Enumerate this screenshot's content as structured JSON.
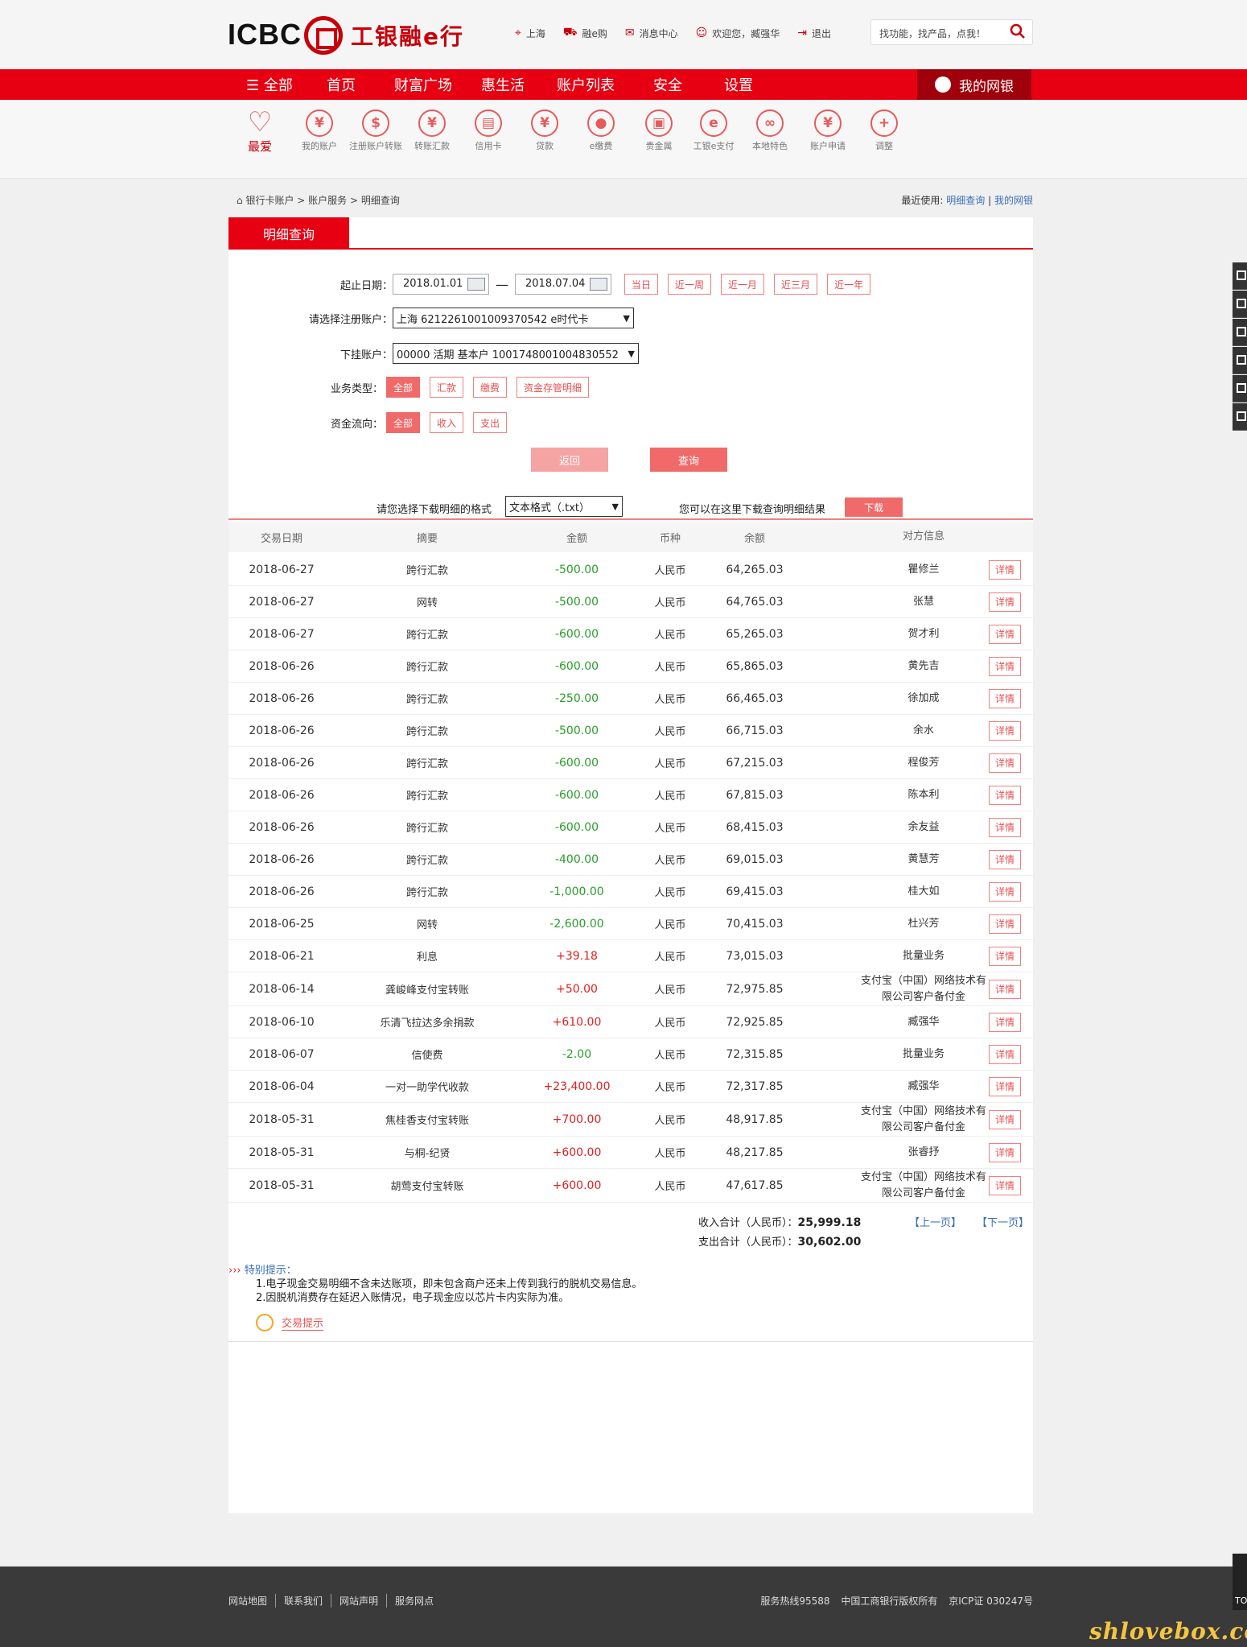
{
  "header": {
    "logo_text": "ICBC",
    "logo_cn": "工银融e行",
    "links": [
      {
        "icon": "location-icon",
        "label": "上海"
      },
      {
        "icon": "cart-icon",
        "label": "融e购"
      },
      {
        "icon": "mail-icon",
        "label": "消息中心"
      },
      {
        "icon": "user-icon",
        "label": "欢迎您，臧强华"
      },
      {
        "icon": "logout-icon",
        "label": "退出"
      }
    ],
    "search_placeholder": "找功能，找产品，点我！"
  },
  "nav": {
    "items": [
      "全部",
      "首页",
      "财富广场",
      "惠生活",
      "账户列表",
      "安全",
      "设置"
    ],
    "mybank": "我的网银"
  },
  "quick_icons": [
    {
      "label": "最爱",
      "glyph": "♡",
      "icon": "heart-icon"
    },
    {
      "label": "我的账户",
      "glyph": "¥",
      "icon": "account-icon"
    },
    {
      "label": "注册账户转账",
      "glyph": "$",
      "icon": "transfer-registered-icon"
    },
    {
      "label": "转账汇款",
      "glyph": "¥",
      "icon": "remittance-icon"
    },
    {
      "label": "信用卡",
      "glyph": "▤",
      "icon": "credit-card-icon"
    },
    {
      "label": "贷款",
      "glyph": "¥",
      "icon": "loan-icon"
    },
    {
      "label": "e缴费",
      "glyph": "●",
      "icon": "epay-icon"
    },
    {
      "label": "贵金属",
      "glyph": "▣",
      "icon": "precious-metal-icon"
    },
    {
      "label": "工银e支付",
      "glyph": "e",
      "icon": "e-payment-icon"
    },
    {
      "label": "本地特色",
      "glyph": "∞",
      "icon": "local-feature-icon"
    },
    {
      "label": "账户申请",
      "glyph": "¥",
      "icon": "account-apply-icon"
    },
    {
      "label": "调整",
      "glyph": "+",
      "icon": "adjust-icon"
    }
  ],
  "breadcrumb": {
    "items": [
      "银行卡账户",
      "账户服务",
      "明细查询"
    ],
    "sep": ">"
  },
  "recent": {
    "label": "最近使用:",
    "links": [
      "明细查询",
      "我的网银"
    ]
  },
  "tab": "明细查询",
  "form": {
    "date_label": "起止日期：",
    "start_date": "2018.01.01",
    "end_date": "2018.07.04",
    "quick_ranges": [
      "当日",
      "近一周",
      "近一月",
      "近三月",
      "近一年"
    ],
    "reg_account_label": "请选择注册账户：",
    "reg_account_value": "上海 6212261001009370542 e时代卡",
    "sub_account_label": "下挂账户：",
    "sub_account_value": "00000 活期 基本户 1001748001004830552",
    "biz_type_label": "业务类型：",
    "biz_types": [
      "全部",
      "汇款",
      "缴费",
      "资金存管明细"
    ],
    "flow_label": "资金流向：",
    "flows": [
      "全部",
      "收入",
      "支出"
    ],
    "back_btn": "返回",
    "query_btn": "查询"
  },
  "download": {
    "format_label": "请您选择下载明细的格式",
    "format_value": "文本格式（.txt）",
    "hint": "您可以在这里下载查询明细结果",
    "btn": "下载"
  },
  "table": {
    "headers": [
      "交易日期",
      "摘要",
      "金额",
      "币种",
      "余额",
      "对方信息"
    ],
    "detail_label": "详情",
    "rows": [
      {
        "date": "2018-06-27",
        "summary": "跨行汇款",
        "amount": "-500.00",
        "currency": "人民币",
        "balance": "64,265.03",
        "party": "瞿修兰"
      },
      {
        "date": "2018-06-27",
        "summary": "网转",
        "amount": "-500.00",
        "currency": "人民币",
        "balance": "64,765.03",
        "party": "张慧"
      },
      {
        "date": "2018-06-27",
        "summary": "跨行汇款",
        "amount": "-600.00",
        "currency": "人民币",
        "balance": "65,265.03",
        "party": "贺才利"
      },
      {
        "date": "2018-06-26",
        "summary": "跨行汇款",
        "amount": "-600.00",
        "currency": "人民币",
        "balance": "65,865.03",
        "party": "黄先吉"
      },
      {
        "date": "2018-06-26",
        "summary": "跨行汇款",
        "amount": "-250.00",
        "currency": "人民币",
        "balance": "66,465.03",
        "party": "徐加成"
      },
      {
        "date": "2018-06-26",
        "summary": "跨行汇款",
        "amount": "-500.00",
        "currency": "人民币",
        "balance": "66,715.03",
        "party": "余水"
      },
      {
        "date": "2018-06-26",
        "summary": "跨行汇款",
        "amount": "-600.00",
        "currency": "人民币",
        "balance": "67,215.03",
        "party": "程俊芳"
      },
      {
        "date": "2018-06-26",
        "summary": "跨行汇款",
        "amount": "-600.00",
        "currency": "人民币",
        "balance": "67,815.03",
        "party": "陈本利"
      },
      {
        "date": "2018-06-26",
        "summary": "跨行汇款",
        "amount": "-600.00",
        "currency": "人民币",
        "balance": "68,415.03",
        "party": "余友益"
      },
      {
        "date": "2018-06-26",
        "summary": "跨行汇款",
        "amount": "-400.00",
        "currency": "人民币",
        "balance": "69,015.03",
        "party": "黄慧芳"
      },
      {
        "date": "2018-06-26",
        "summary": "跨行汇款",
        "amount": "-1,000.00",
        "currency": "人民币",
        "balance": "69,415.03",
        "party": "桂大如"
      },
      {
        "date": "2018-06-25",
        "summary": "网转",
        "amount": "-2,600.00",
        "currency": "人民币",
        "balance": "70,415.03",
        "party": "杜兴芳"
      },
      {
        "date": "2018-06-21",
        "summary": "利息",
        "amount": "+39.18",
        "currency": "人民币",
        "balance": "73,015.03",
        "party": "批量业务"
      },
      {
        "date": "2018-06-14",
        "summary": "龚峻峰支付宝转账",
        "amount": "+50.00",
        "currency": "人民币",
        "balance": "72,975.85",
        "party": "支付宝（中国）网络技术有限公司客户备付金"
      },
      {
        "date": "2018-06-10",
        "summary": "乐清飞拉达多余捐款",
        "amount": "+610.00",
        "currency": "人民币",
        "balance": "72,925.85",
        "party": "臧强华"
      },
      {
        "date": "2018-06-07",
        "summary": "信使费",
        "amount": "-2.00",
        "currency": "人民币",
        "balance": "72,315.85",
        "party": "批量业务"
      },
      {
        "date": "2018-06-04",
        "summary": "一对一助学代收款",
        "amount": "+23,400.00",
        "currency": "人民币",
        "balance": "72,317.85",
        "party": "臧强华"
      },
      {
        "date": "2018-05-31",
        "summary": "焦桂香支付宝转账",
        "amount": "+700.00",
        "currency": "人民币",
        "balance": "48,917.85",
        "party": "支付宝（中国）网络技术有限公司客户备付金"
      },
      {
        "date": "2018-05-31",
        "summary": "与桐-纪贤",
        "amount": "+600.00",
        "currency": "人民币",
        "balance": "48,217.85",
        "party": "张睿抒"
      },
      {
        "date": "2018-05-31",
        "summary": "胡莺支付宝转账",
        "amount": "+600.00",
        "currency": "人民币",
        "balance": "47,617.85",
        "party": "支付宝（中国）网络技术有限公司客户备付金"
      }
    ]
  },
  "totals": {
    "income_label": "收入合计（人民币）：",
    "income_value": "25,999.18",
    "expense_label": "支出合计（人民币）：",
    "expense_value": "30,602.00",
    "prev": "【上一页】",
    "next": "【下一页】"
  },
  "tips": {
    "title": "特别提示：",
    "lines": [
      "1.电子现金交易明细不含未达账项，即未包含商户还未上传到我行的脱机交易信息。",
      "2.因脱机消费存在延迟入账情况，电子现金应以芯片卡内实际为准。"
    ],
    "tx_tab": "交易提示"
  },
  "footer": {
    "links": [
      "网站地图",
      "联系我们",
      "网站声明",
      "服务网点"
    ],
    "hotline": "服务热线95588",
    "copyright": "中国工商银行版权所有",
    "icp": "京ICP证 030247号"
  },
  "watermark": "shlovebox.com",
  "colors": {
    "brand_red": "#e60012",
    "dark_red": "#a0000b",
    "negative": "#2a9d2a",
    "positive": "#e02020",
    "link": "#3a6fb5"
  }
}
